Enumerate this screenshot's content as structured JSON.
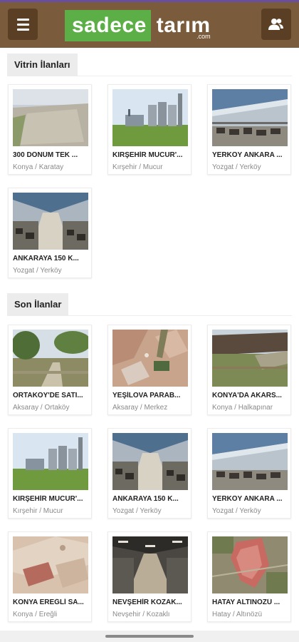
{
  "header": {
    "logo_part1": "sadece",
    "logo_part2": "tarım",
    "logo_suffix": ".com",
    "menu_icon": "hamburger-menu-icon",
    "user_icon": "users-icon",
    "bar_color": "#7a5b3c",
    "logo_green": "#5cae47"
  },
  "showcase": {
    "title": "Vitrin İlanları",
    "items": [
      {
        "title": "300 DÖNÜM TEK ...",
        "location": "Konya / Karatay"
      },
      {
        "title": "KIRŞEHİR MUCUR'...",
        "location": "Kırşehir / Mucur"
      },
      {
        "title": "YERKÖY ANKARA ...",
        "location": "Yozgat / Yerköy"
      },
      {
        "title": "ANKARAYA 150 K...",
        "location": "Yozgat / Yerköy"
      }
    ]
  },
  "recent": {
    "title": "Son İlanlar",
    "items": [
      {
        "title": "ORTAKÖY'DE SATI...",
        "location": "Aksaray / Ortaköy"
      },
      {
        "title": "YEŞİLOVA PARAB...",
        "location": "Aksaray / Merkez"
      },
      {
        "title": "KONYA'DA AKARS...",
        "location": "Konya / Halkapınar"
      },
      {
        "title": "KIRŞEHİR MUCUR'...",
        "location": "Kırşehir / Mucur"
      },
      {
        "title": "ANKARAYA 150 K...",
        "location": "Yozgat / Yerköy"
      },
      {
        "title": "YERKÖY ANKARA ...",
        "location": "Yozgat / Yerköy"
      },
      {
        "title": "KONYA EREĞLİ SA...",
        "location": "Konya / Ereğli"
      },
      {
        "title": "NEVŞEHİR KOZAK...",
        "location": "Nevşehir / Kozaklı"
      },
      {
        "title": "HATAY ALTINÖZÜ ...",
        "location": "Hatay / Altınözü"
      }
    ]
  }
}
